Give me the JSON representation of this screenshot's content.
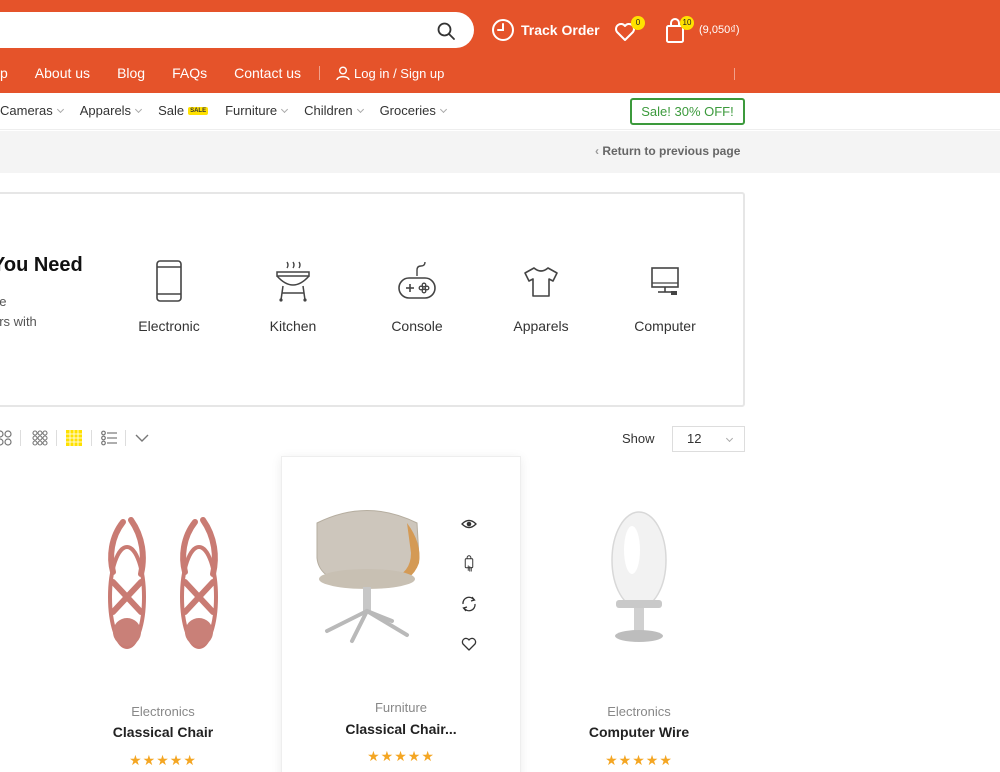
{
  "header": {
    "track_order": "Track Order",
    "wishlist_count": "0",
    "cart_count": "10",
    "cart_total": "(9,050₫)"
  },
  "main_nav": {
    "items": [
      "p",
      "About us",
      "Blog",
      "FAQs",
      "Contact us"
    ],
    "login": "Log in / Sign up"
  },
  "category_nav": {
    "items": [
      {
        "label": "Cameras"
      },
      {
        "label": "Apparels"
      },
      {
        "label": "Sale",
        "badge": "SALE"
      },
      {
        "label": "Furniture"
      },
      {
        "label": "Children"
      },
      {
        "label": "Groceries"
      }
    ],
    "sale_button": "Sale! 30% OFF!"
  },
  "breadcrumb": {
    "return_link": "Return to previous page"
  },
  "category_box": {
    "title": "You Need",
    "description_lines": [
      "ne",
      "ers with"
    ],
    "categories": [
      {
        "label": "Electronic",
        "icon": "smartphone-icon"
      },
      {
        "label": "Kitchen",
        "icon": "grill-icon"
      },
      {
        "label": "Console",
        "icon": "gamepad-icon"
      },
      {
        "label": "Apparels",
        "icon": "tshirt-icon"
      },
      {
        "label": "Computer",
        "icon": "monitor-icon"
      }
    ]
  },
  "toolbar": {
    "show_label": "Show",
    "show_value": "12",
    "active_view": "grid-4"
  },
  "products": [
    {
      "category": "Electronics",
      "name": "Classical Chair",
      "rating": 5,
      "stars": "★★★★★"
    },
    {
      "category": "Furniture",
      "name": "Classical Chair...",
      "rating": 5,
      "stars": "★★★★★"
    },
    {
      "category": "Electronics",
      "name": "Computer Wire",
      "rating": 5,
      "stars": "★★★★★"
    }
  ],
  "colors": {
    "brand": "#e5532a",
    "accent_yellow": "#ffe100",
    "sale_green": "#3c9a3c",
    "star": "#f4a623"
  }
}
